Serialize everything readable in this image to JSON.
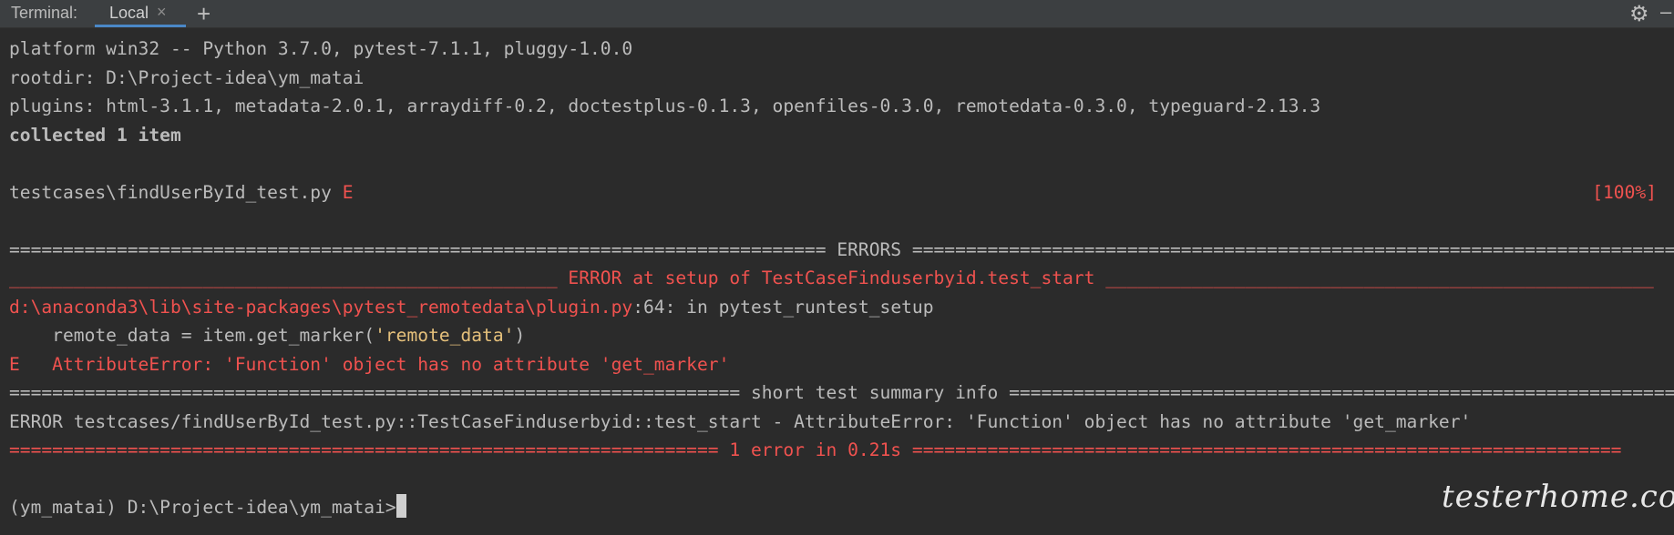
{
  "tabbar": {
    "title": "Terminal:",
    "tab_label": "Local",
    "close_glyph": "×",
    "add_glyph": "+",
    "settings_glyph": "⚙",
    "hide_glyph": "–"
  },
  "icons": {
    "close": "close-icon",
    "add": "plus-icon",
    "settings": "gear-icon",
    "hide": "minimize-icon"
  },
  "colors": {
    "background": "#2b2b2b",
    "text": "#bbbbbb",
    "error": "#f0524f",
    "string": "#e5c07b",
    "tab_underline": "#4a88c7"
  },
  "terminal": {
    "platform": "platform win32 -- Python 3.7.0, pytest-7.1.1, pluggy-1.0.0",
    "rootdir": "rootdir: D:\\Project-idea\\ym_matai",
    "plugins": "plugins: html-3.1.1, metadata-2.0.1, arraydiff-0.2, doctestplus-0.1.3, openfiles-0.3.0, remotedata-0.3.0, typeguard-2.13.3",
    "collected": "collected 1 item",
    "test_file": "testcases\\findUserById_test.py ",
    "test_result": "E",
    "progress": "[100%]",
    "errors_header": "============================================================================ ERRORS ============================================================================",
    "error_setup": "___________________________________________________ ERROR at setup of TestCaseFinduserbyid.test_start ___________________________________________________",
    "trace_path": "d:\\anaconda3\\lib\\site-packages\\pytest_remotedata\\plugin.py",
    "trace_loc": ":64: in pytest_runtest_setup",
    "code_prefix": "    remote_data = item.get_marker(",
    "code_string": "'remote_data'",
    "code_suffix": ")",
    "error_line": "E   AttributeError: 'Function' object has no attribute 'get_marker'",
    "summary_header": "==================================================================== short test summary info ====================================================================",
    "summary_error": "ERROR testcases/findUserById_test.py::TestCaseFinduserbyid::test_start - AttributeError: 'Function' object has no attribute 'get_marker'",
    "final_line": "================================================================== 1 error in 0.21s ==================================================================",
    "prompt": "(ym_matai) D:\\Project-idea\\ym_matai>"
  },
  "watermark": "testerhome.com"
}
